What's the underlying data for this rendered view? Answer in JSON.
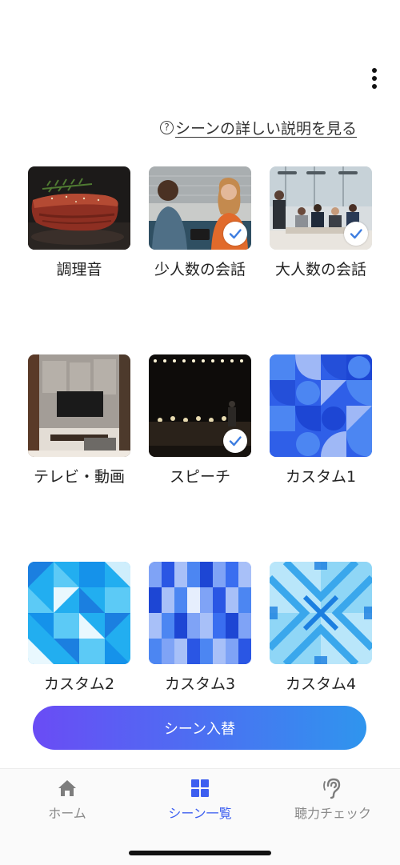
{
  "header": {
    "more_icon": "more-vertical-icon",
    "help_icon_glyph": "?",
    "help_link_text": "シーンの詳しい説明を見る"
  },
  "scenes": [
    {
      "label": "調理音",
      "selected": false,
      "image": "grilled-steak-photo"
    },
    {
      "label": "少人数の会話",
      "selected": true,
      "image": "two-people-talking-photo"
    },
    {
      "label": "大人数の会話",
      "selected": true,
      "image": "meeting-room-photo"
    },
    {
      "label": "テレビ・動画",
      "selected": false,
      "image": "living-room-tv-photo"
    },
    {
      "label": "スピーチ",
      "selected": true,
      "image": "stage-speech-photo"
    },
    {
      "label": "カスタム1",
      "selected": false,
      "image": "blue-geometric-pattern-1"
    },
    {
      "label": "カスタム2",
      "selected": false,
      "image": "blue-geometric-pattern-2"
    },
    {
      "label": "カスタム3",
      "selected": false,
      "image": "blue-geometric-pattern-3"
    },
    {
      "label": "カスタム4",
      "selected": false,
      "image": "blue-geometric-pattern-4"
    }
  ],
  "switch_button_label": "シーン入替",
  "tabs": [
    {
      "label": "ホーム",
      "icon": "home-icon",
      "active": false
    },
    {
      "label": "シーン一覧",
      "icon": "grid-icon",
      "active": true
    },
    {
      "label": "聴力チェック",
      "icon": "ear-icon",
      "active": false
    }
  ],
  "colors": {
    "accent": "#3d5ff0",
    "button_gradient_start": "#6a4cf5",
    "button_gradient_end": "#2f95ee",
    "inactive_tab": "#8a8a8a"
  }
}
